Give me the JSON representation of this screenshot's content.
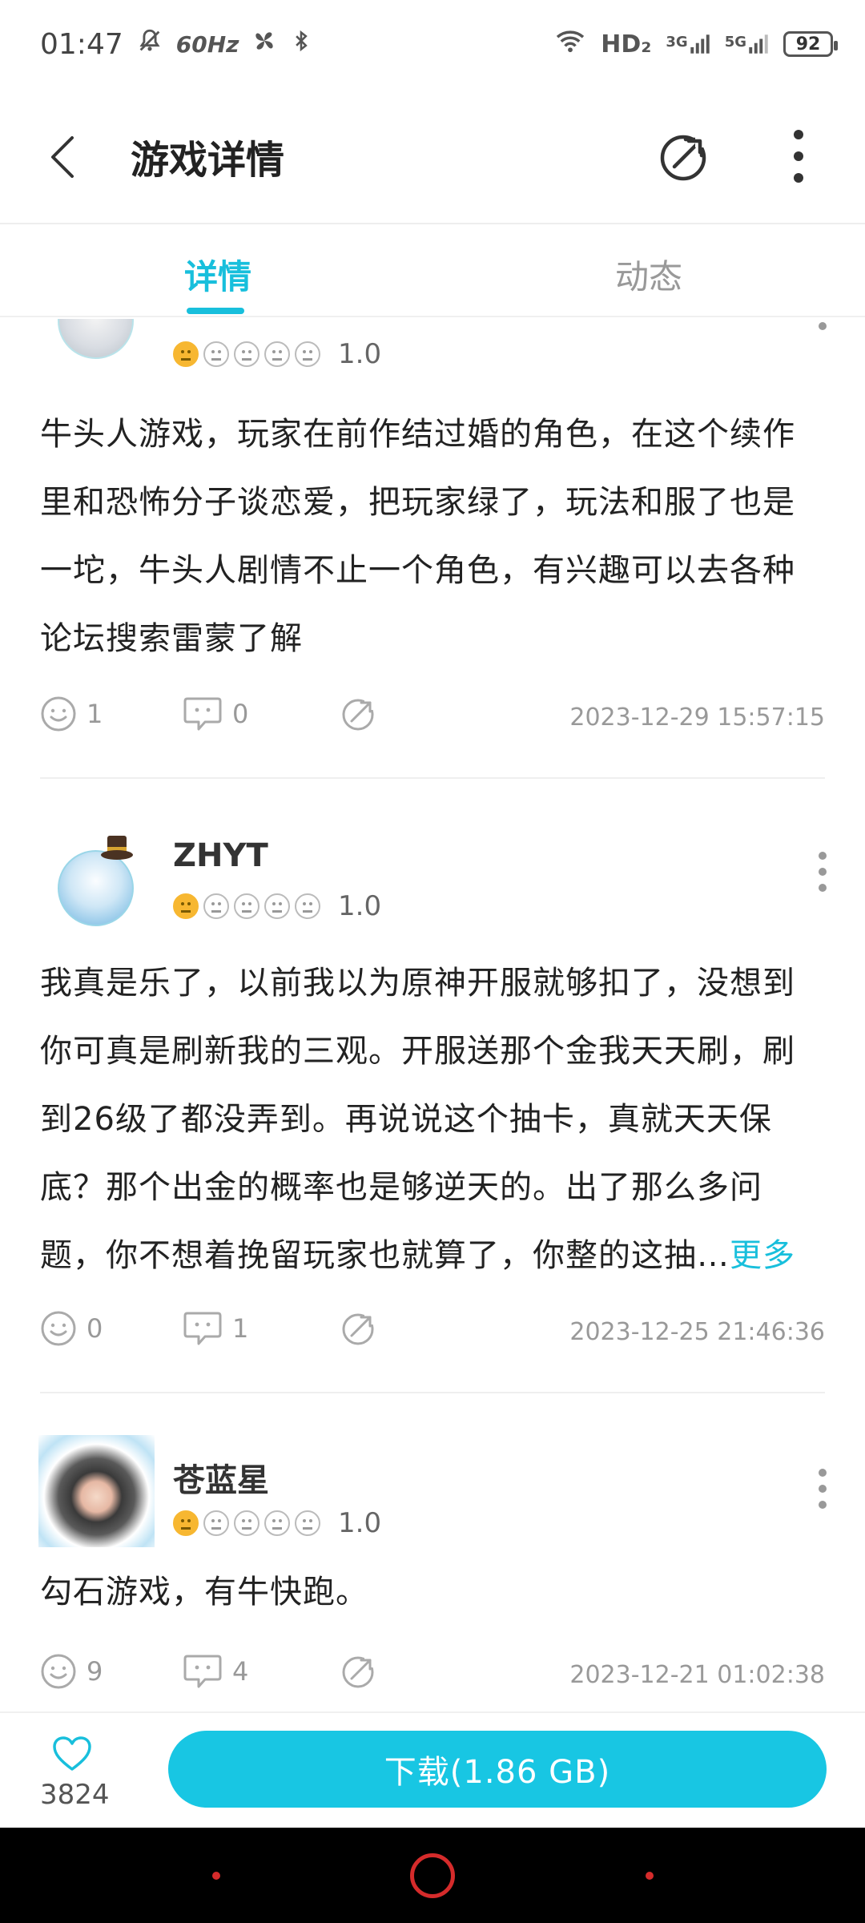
{
  "status_bar": {
    "time": "01:47",
    "refresh_rate": "60Hz",
    "network_label": "HD₂",
    "sim1": "3G",
    "sim2": "5G",
    "battery": "92"
  },
  "header": {
    "title": "游戏详情"
  },
  "tabs": [
    {
      "label": "详情",
      "active": true
    },
    {
      "label": "动态",
      "active": false
    }
  ],
  "reviews": [
    {
      "username": "",
      "rating": "1.0",
      "text": "牛头人游戏，玩家在前作结过婚的角色，在这个续作里和恐怖分子谈恋爱，把玩家绿了，玩法和服了也是一坨，牛头人剧情不止一个角色，有兴趣可以去各种论坛搜索雷蒙了解",
      "likes": "1",
      "comments": "0",
      "timestamp": "2023-12-29 15:57:15"
    },
    {
      "username": "ZHYT",
      "rating": "1.0",
      "text": "我真是乐了，以前我以为原神开服就够扣了，没想到你可真是刷新我的三观。开服送那个金我天天刷，刷到26级了都没弄到。再说说这个抽卡，真就天天保底？那个出金的概率也是够逆天的。出了那么多问题，你不想着挽留玩家也就算了，你整的这抽…",
      "more": "更多",
      "likes": "0",
      "comments": "1",
      "timestamp": "2023-12-25 21:46:36"
    },
    {
      "username": "苍蓝星",
      "rating": "1.0",
      "text": "勾石游戏，有牛快跑。",
      "likes": "9",
      "comments": "4",
      "timestamp": "2023-12-21 01:02:38"
    }
  ],
  "bottom_bar": {
    "favorites_count": "3824",
    "download_label": "下载(1.86 GB)"
  },
  "colors": {
    "accent": "#18bfdc",
    "rating_face": "#f7b731",
    "navbar": "#000000",
    "nav_buttons": "#d52b2b"
  }
}
